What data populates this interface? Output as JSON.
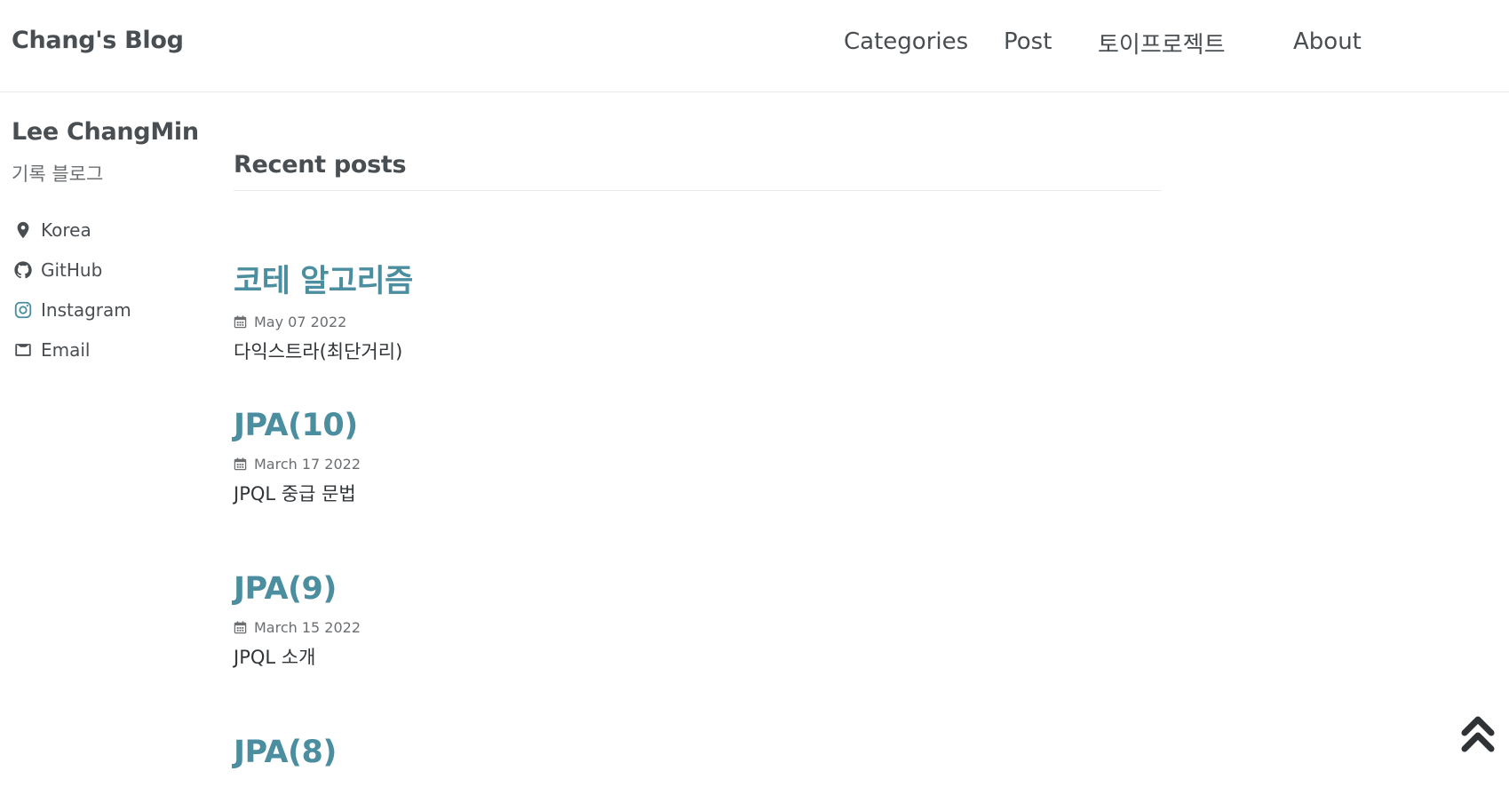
{
  "site": {
    "title": "Chang's Blog"
  },
  "nav": {
    "items": [
      {
        "label": "Categories"
      },
      {
        "label": "Post"
      },
      {
        "label": "토이프로젝트"
      },
      {
        "label": "About"
      }
    ]
  },
  "author": {
    "name": "Lee ChangMin",
    "bio": "기록 블로그",
    "links": [
      {
        "label": "Korea",
        "icon": "map-marker-icon"
      },
      {
        "label": "GitHub",
        "icon": "github-icon"
      },
      {
        "label": "Instagram",
        "icon": "instagram-icon"
      },
      {
        "label": "Email",
        "icon": "envelope-icon"
      }
    ]
  },
  "main": {
    "heading": "Recent posts",
    "posts": [
      {
        "title": "코테 알고리즘",
        "date": "May 07 2022",
        "excerpt": "다익스트라(최단거리)"
      },
      {
        "title": "JPA(10)",
        "date": "March 17 2022",
        "excerpt": "JPQL 중급 문법"
      },
      {
        "title": "JPA(9)",
        "date": "March 15 2022",
        "excerpt": "JPQL 소개"
      },
      {
        "title": "JPA(8)",
        "date": "",
        "excerpt": ""
      }
    ]
  },
  "colors": {
    "accent": "#4a8ea0",
    "text": "#494e52",
    "instagram_icon": "#4a8ea0"
  }
}
